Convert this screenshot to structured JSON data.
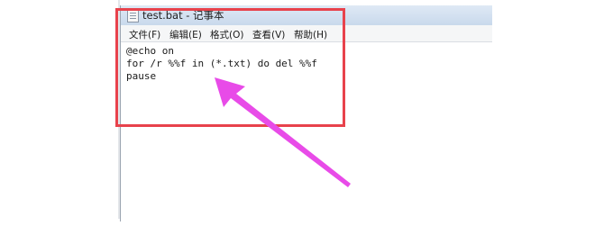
{
  "window": {
    "title": "test.bat - 记事本",
    "menu": [
      "文件(F)",
      "编辑(E)",
      "格式(O)",
      "查看(V)",
      "帮助(H)"
    ]
  },
  "editor": {
    "lines": [
      "@echo on",
      "for /r %%f in (*.txt) do del %%f",
      "pause"
    ]
  },
  "colors": {
    "highlight": "#e8424c",
    "arrow": "#e84be8"
  },
  "icons": {
    "app": "notepad-icon",
    "annotation": "arrow-icon"
  }
}
